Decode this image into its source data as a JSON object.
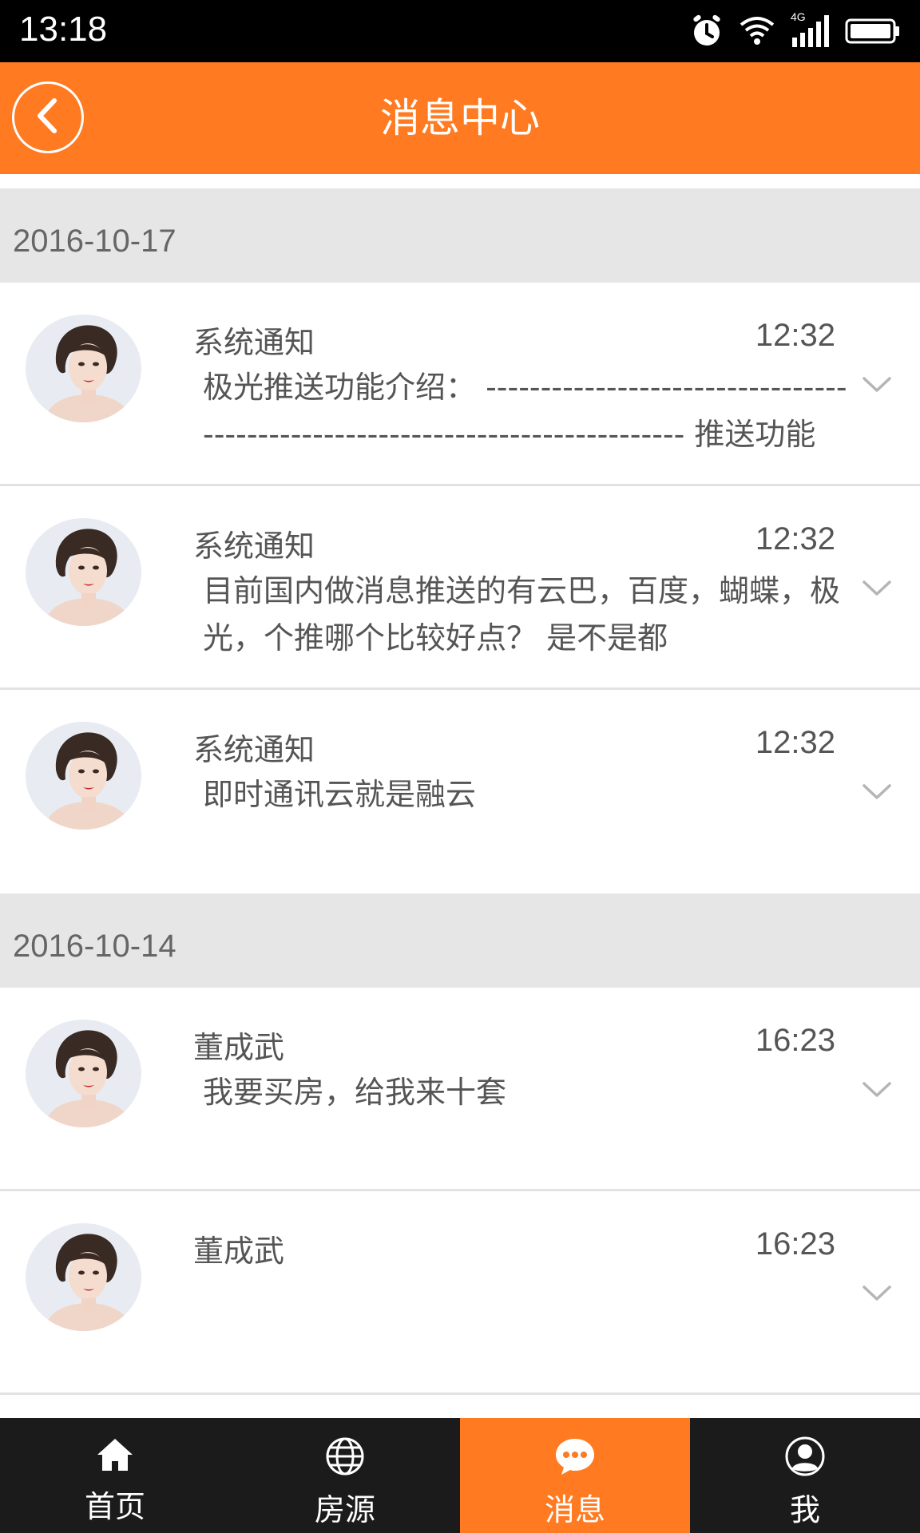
{
  "status_bar": {
    "time": "13:18",
    "network_label": "4G",
    "icons": [
      "alarm-icon",
      "wifi-icon",
      "signal-icon",
      "battery-icon"
    ]
  },
  "header": {
    "title": "消息中心",
    "back_icon": "back-arrow-icon"
  },
  "groups": [
    {
      "date": "2016-10-17",
      "messages": [
        {
          "sender": "系统通知",
          "time": "12:32",
          "body": "极光推送功能介绍： ----------------------------------------------------------------------------- 推送功能 功能介绍"
        },
        {
          "sender": "系统通知",
          "time": "12:32",
          "body": "目前国内做消息推送的有云巴，百度，蝴蝶，极光，个推哪个比较好点？ 是不是都"
        },
        {
          "sender": "系统通知",
          "time": "12:32",
          "body": "即时通讯云就是融云"
        }
      ]
    },
    {
      "date": "2016-10-14",
      "messages": [
        {
          "sender": "董成武",
          "time": "16:23",
          "body": "我要买房，给我来十套"
        },
        {
          "sender": "董成武",
          "time": "16:23",
          "body": ""
        }
      ]
    }
  ],
  "bottom_nav": [
    {
      "label": "首页",
      "icon": "home-icon",
      "active": false
    },
    {
      "label": "房源",
      "icon": "globe-icon",
      "active": false
    },
    {
      "label": "消息",
      "icon": "chat-bubble-icon",
      "active": true
    },
    {
      "label": "我",
      "icon": "user-icon",
      "active": false
    }
  ],
  "colors": {
    "accent": "#ff7a21",
    "status_bar": "#000000",
    "nav_bar": "#1b1b1b",
    "date_header_bg": "#e6e6e6",
    "text": "#555555"
  }
}
